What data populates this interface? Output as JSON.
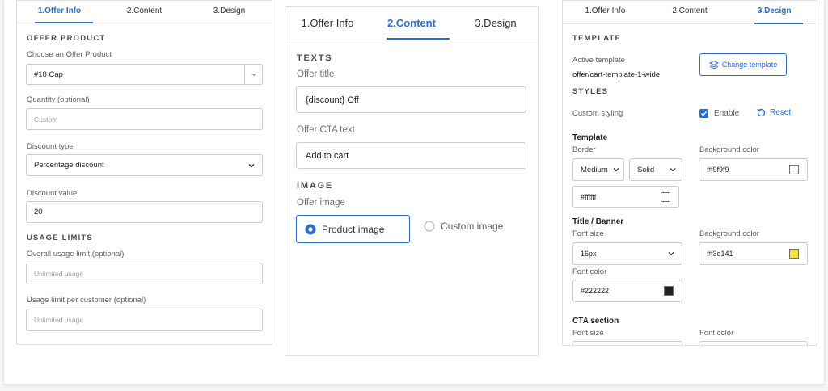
{
  "left": {
    "tabs": [
      "1.Offer Info",
      "2.Content",
      "3.Design"
    ],
    "offer_product_heading": "OFFER PRODUCT",
    "choose_label": "Choose an Offer Product",
    "product_value": "#18 Cap",
    "quantity_label": "Quantity (optional)",
    "quantity_placeholder": "Custom",
    "discount_type_label": "Discount type",
    "discount_type_value": "Percentage discount",
    "discount_value_label": "Discount value",
    "discount_value": "20",
    "usage_heading": "USAGE LIMITS",
    "overall_label": "Overall usage limit (optional)",
    "overall_placeholder": "Unlimited usage",
    "per_customer_label": "Usage limit per customer (optional)",
    "per_customer_placeholder": "Unlimited usage"
  },
  "middle": {
    "tabs": [
      "1.Offer Info",
      "2.Content",
      "3.Design"
    ],
    "texts_heading": "TEXTS",
    "offer_title_label": "Offer title",
    "offer_title_value": "{discount} Off",
    "cta_label": "Offer CTA text",
    "cta_value": "Add to cart",
    "image_heading": "IMAGE",
    "offer_image_label": "Offer image",
    "product_image_option": "Product image",
    "custom_image_option": "Custom image"
  },
  "right": {
    "tabs": [
      "1.Offer Info",
      "2.Content",
      "3.Design"
    ],
    "template_heading": "TEMPLATE",
    "active_template_label": "Active template",
    "active_template_value": "offer/cart-template-1-wide",
    "change_template_button": "Change template",
    "styles_heading": "STYLES",
    "custom_styling_label": "Custom styling",
    "enable_label": "Enable",
    "reset_label": "Reset",
    "template_group": "Template",
    "border_label": "Border",
    "border_width_value": "Medium",
    "border_style_value": "Solid",
    "background_color_label": "Background color",
    "background_color_value": "#f9f9f9",
    "border_color_value": "#ffffff",
    "title_banner_group": "Title / Banner",
    "font_size_label": "Font size",
    "title_font_size_value": "16px",
    "title_bg_label": "Background color",
    "title_bg_value": "#f3e141",
    "font_color_label": "Font color",
    "title_font_color_value": "#222222",
    "cta_section_group": "CTA section",
    "cta_font_size_label": "Font size",
    "cta_font_color_label": "Font color"
  },
  "colors": {
    "accent": "#2c6ecb",
    "swatch_background": "#f9f9f9",
    "swatch_border": "#ffffff",
    "swatch_title_bg": "#f3e141",
    "swatch_title_font": "#222222"
  }
}
